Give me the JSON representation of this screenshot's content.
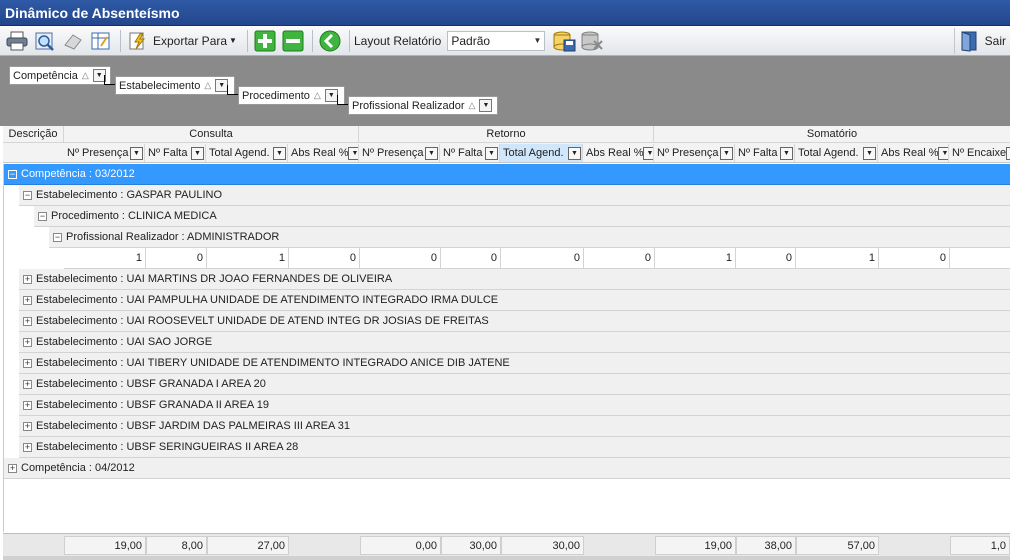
{
  "window": {
    "title": "Dinâmico de Absenteísmo"
  },
  "toolbar": {
    "export_label": "Exportar Para",
    "layout_label": "Layout Relatório",
    "layout_value": "Padrão",
    "exit_label": "Sair"
  },
  "group_area": {
    "chips": [
      {
        "label": "Competência"
      },
      {
        "label": "Estabelecimento"
      },
      {
        "label": "Procedimento"
      },
      {
        "label": "Profissional Realizador"
      }
    ]
  },
  "grid": {
    "desc_header": "Descrição",
    "bands": [
      "Consulta",
      "Retorno",
      "Somatório"
    ],
    "columns": [
      "Nº Presença",
      "Nº Falta",
      "Total Agend.",
      "Abs Real %",
      "Nº Presença",
      "Nº Falta",
      "Total Agend.",
      "Abs Real %",
      "Nº Presença",
      "Nº Falta",
      "Total Agend.",
      "Abs Real %",
      "Nº Encaixe"
    ],
    "rows": [
      {
        "text": "Competência : 03/2012",
        "expander": "−"
      },
      {
        "text": "Estabelecimento : GASPAR PAULINO",
        "expander": "−"
      },
      {
        "text": "Procedimento : CLINICA MEDICA",
        "expander": "−"
      },
      {
        "text": "Profissional Realizador : ADMINISTRADOR",
        "expander": "−"
      },
      {
        "text": "Estabelecimento : UAI MARTINS DR JOAO FERNANDES DE OLIVEIRA",
        "expander": "+"
      },
      {
        "text": "Estabelecimento : UAI PAMPULHA UNIDADE DE ATENDIMENTO INTEGRADO IRMA DULCE",
        "expander": "+"
      },
      {
        "text": "Estabelecimento : UAI ROOSEVELT UNIDADE DE ATEND INTEG DR JOSIAS DE FREITAS",
        "expander": "+"
      },
      {
        "text": "Estabelecimento : UAI SAO JORGE",
        "expander": "+"
      },
      {
        "text": "Estabelecimento : UAI TIBERY UNIDADE DE ATENDIMENTO INTEGRADO ANICE DIB JATENE",
        "expander": "+"
      },
      {
        "text": "Estabelecimento : UBSF GRANADA I AREA 20",
        "expander": "+"
      },
      {
        "text": "Estabelecimento : UBSF GRANADA II AREA 19",
        "expander": "+"
      },
      {
        "text": "Estabelecimento : UBSF JARDIM DAS PALMEIRAS III AREA 31",
        "expander": "+"
      },
      {
        "text": "Estabelecimento : UBSF SERINGUEIRAS II AREA 28",
        "expander": "+"
      },
      {
        "text": "Competência : 04/2012",
        "expander": "+"
      }
    ],
    "data_row": [
      "1",
      "0",
      "1",
      "0",
      "0",
      "0",
      "0",
      "0",
      "1",
      "0",
      "1",
      "0"
    ],
    "totals": [
      "19,00",
      "8,00",
      "27,00",
      "0,00",
      "30,00",
      "30,00",
      "19,00",
      "38,00",
      "57,00",
      "1,0"
    ]
  }
}
